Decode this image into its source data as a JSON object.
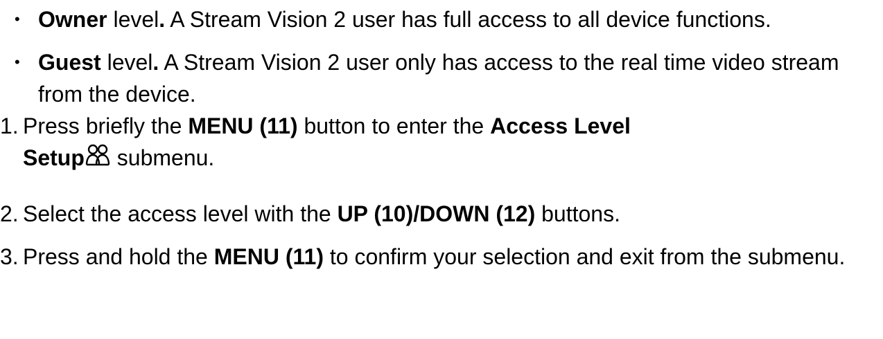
{
  "list": {
    "owner": {
      "bold": "Owner",
      "rest": " level",
      "dot": ".",
      "desc": "  A Stream Vision 2 user has full access to all device functions."
    },
    "guest": {
      "bold": "Guest",
      "rest": " level",
      "dot": ".",
      "desc": " A Stream Vision 2 user only has access to the real time video stream from the device."
    }
  },
  "steps": [
    {
      "number": "1.",
      "t1": "Press briefly the ",
      "b1": "MENU (11)",
      "t2": " button to enter the ",
      "b2": "Access Level Setup",
      "icon": "people-icon",
      "t3": " submenu."
    },
    {
      "number": "2.",
      "t1": "Select the access level with the ",
      "b1": "UP (10)/DOWN (12)",
      "t2": " buttons."
    },
    {
      "number": "3.",
      "t1": "Press and hold the ",
      "b1": "MENU (11)",
      "t2": " to confirm your selection and exit from the submenu."
    }
  ]
}
